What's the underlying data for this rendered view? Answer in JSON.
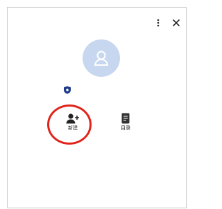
{
  "window": {
    "menu_icon": "more-vertical-icon",
    "close_icon": "close-icon"
  },
  "profile": {
    "avatar_icon": "person-icon",
    "avatar_color": "#c7d7ef",
    "badge_icon": "shield-icon"
  },
  "actions": {
    "add_contact": {
      "label": "新建",
      "icon": "person-add-icon"
    },
    "directory": {
      "label": "目录",
      "icon": "book-icon"
    }
  },
  "highlight": {
    "color": "#e0241b",
    "target": "add_contact"
  }
}
